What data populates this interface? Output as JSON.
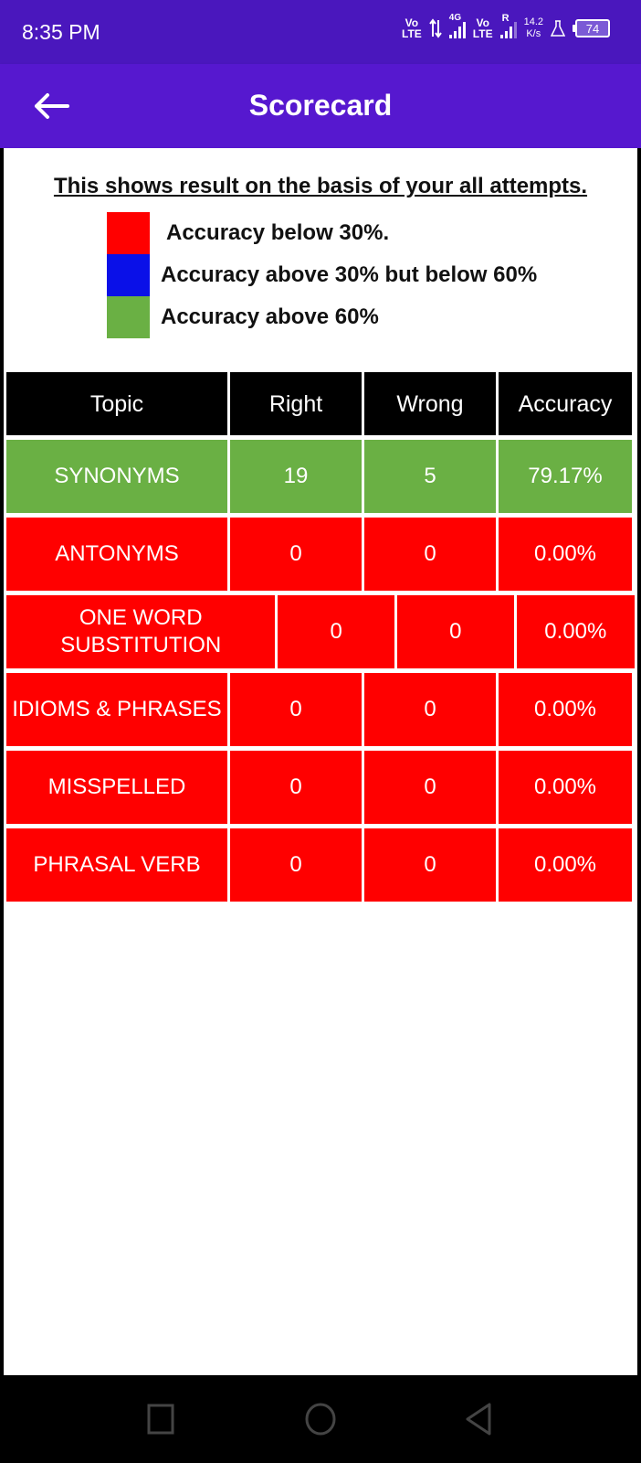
{
  "status_bar": {
    "time": "8:35 PM",
    "sim1": {
      "top": "Vo",
      "bottom": "LTE"
    },
    "network_type": "4G",
    "sim2": {
      "top": "Vo",
      "bottom": "LTE",
      "roaming": "R"
    },
    "speed_value": "14.2",
    "speed_unit": "K/s",
    "battery_level": "74",
    "icons": [
      "volte-icon",
      "data-arrows-icon",
      "signal-4g-icon",
      "volte-icon",
      "signal-roaming-icon",
      "flask-icon",
      "battery-icon"
    ]
  },
  "app_bar": {
    "title": "Scorecard",
    "back_icon": "arrow-left-icon"
  },
  "legend": {
    "title": "This shows result on the basis of your all attempts.",
    "items": [
      {
        "label": "Accuracy below 30%.",
        "color": "#ff0000"
      },
      {
        "label": "Accuracy above 30% but below 60%",
        "color": "#0a10e8"
      },
      {
        "label": "Accuracy above 60%",
        "color": "#6ab044"
      }
    ]
  },
  "table": {
    "headers": [
      "Topic",
      "Right",
      "Wrong",
      "Accuracy"
    ],
    "rows": [
      {
        "topic": "SYNONYMS",
        "right": "19",
        "wrong": "5",
        "accuracy": "79.17%",
        "color": "#6ab044"
      },
      {
        "topic": "ANTONYMS",
        "right": "0",
        "wrong": "0",
        "accuracy": "0.00%",
        "color": "#ff0000"
      },
      {
        "topic": "ONE WORD SUBSTITUTION",
        "right": "0",
        "wrong": "0",
        "accuracy": "0.00%",
        "color": "#ff0000"
      },
      {
        "topic": "IDIOMS & PHRASES",
        "right": "0",
        "wrong": "0",
        "accuracy": "0.00%",
        "color": "#ff0000"
      },
      {
        "topic": "MISSPELLED",
        "right": "0",
        "wrong": "0",
        "accuracy": "0.00%",
        "color": "#ff0000"
      },
      {
        "topic": "PHRASAL VERB",
        "right": "0",
        "wrong": "0",
        "accuracy": "0.00%",
        "color": "#ff0000"
      }
    ]
  },
  "nav_bar": {
    "buttons": [
      "recents-square-icon",
      "home-circle-icon",
      "back-triangle-icon"
    ]
  },
  "colors": {
    "status_bar": "#4a17bd",
    "app_bar": "#5618cf",
    "header_cell": "#000000"
  }
}
